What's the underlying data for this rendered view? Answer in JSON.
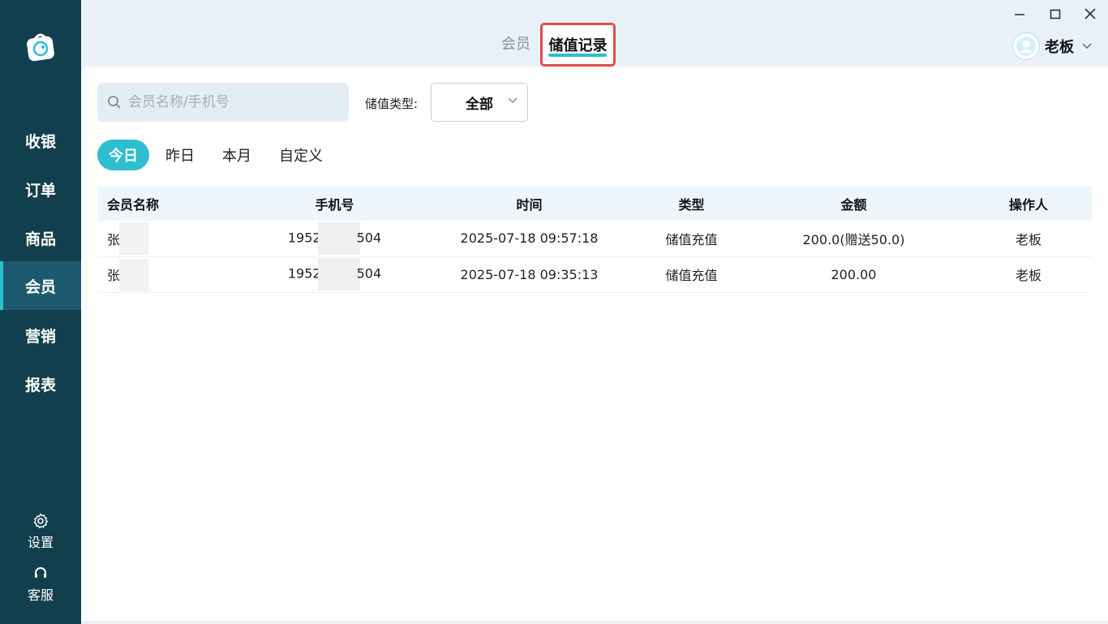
{
  "sidebar": {
    "items": [
      {
        "label": "收银"
      },
      {
        "label": "订单"
      },
      {
        "label": "商品"
      },
      {
        "label": "会员"
      },
      {
        "label": "营销"
      },
      {
        "label": "报表"
      }
    ],
    "active_index": 3,
    "settings_label": "设置",
    "service_label": "客服"
  },
  "header": {
    "tabs": [
      {
        "label": "会员"
      },
      {
        "label": "储值记录"
      }
    ],
    "active_tab": "储值记录",
    "user_name": "老板"
  },
  "filters": {
    "search_placeholder": "会员名称/手机号",
    "type_label": "储值类型:",
    "type_value": "全部",
    "date_tabs": [
      {
        "label": "今日"
      },
      {
        "label": "昨日"
      },
      {
        "label": "本月"
      },
      {
        "label": "自定义"
      }
    ],
    "active_date_tab": "今日"
  },
  "table": {
    "columns": [
      "会员名称",
      "手机号",
      "时间",
      "类型",
      "金额",
      "操作人"
    ],
    "rows": [
      {
        "name": "张",
        "phone": "1952",
        "phone_tail": "504",
        "time": "2025-07-18 09:57:18",
        "type": "储值充值",
        "amount": "200.0(赠送50.0)",
        "operator": "老板"
      },
      {
        "name": "张",
        "phone": "1952",
        "phone_tail": "504",
        "time": "2025-07-18 09:35:13",
        "type": "储值充值",
        "amount": "200.00",
        "operator": "老板"
      }
    ]
  },
  "colors": {
    "sidebar_bg": "#123f4e",
    "accent": "#2dbfd0",
    "highlight_border": "#e24c4c"
  }
}
